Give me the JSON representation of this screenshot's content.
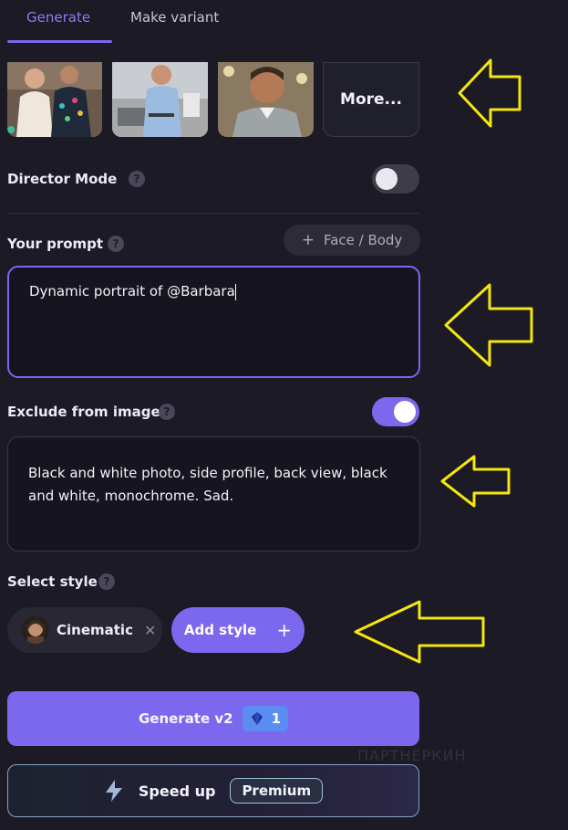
{
  "tabs": [
    {
      "label": "Generate"
    },
    {
      "label": "Make variant"
    }
  ],
  "models": {
    "more_label": "More..."
  },
  "director_mode": {
    "label": "Director Mode",
    "enabled": false
  },
  "prompt": {
    "label": "Your prompt",
    "face_body_button": "Face / Body",
    "value": "Dynamic portrait of @Barbara"
  },
  "exclude": {
    "label": "Exclude from image",
    "enabled": true,
    "value": "Black and white photo, side profile, back view, black and white, monochrome. Sad."
  },
  "style": {
    "label": "Select style",
    "selected": "Cinematic",
    "add_label": "Add style"
  },
  "generate": {
    "label": "Generate v2",
    "credits": "1"
  },
  "speed_up": {
    "label": "Speed up",
    "badge": "Premium"
  },
  "watermark": "ПАРТНЕРКИН",
  "colors": {
    "accent": "#7b68ee",
    "background": "#1b1a25",
    "annotation_arrow": "#f5e60f"
  }
}
